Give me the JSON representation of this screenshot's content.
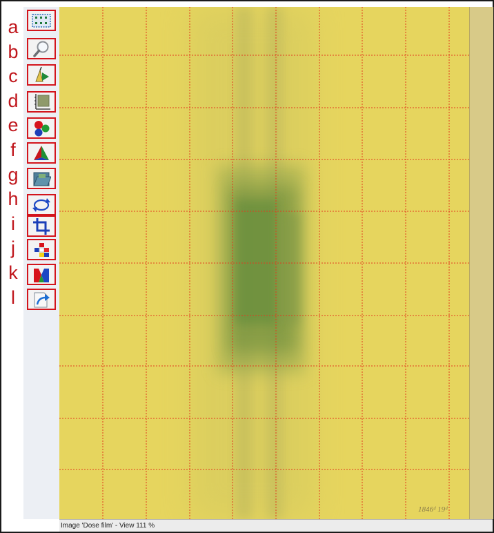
{
  "labels": [
    "a",
    "b",
    "c",
    "d",
    "e",
    "f",
    "g",
    "h",
    "i",
    "j",
    "k",
    "l"
  ],
  "toolbar": {
    "buttons": [
      {
        "icon": "selection-grid-icon"
      },
      {
        "icon": "magnifier-icon"
      },
      {
        "icon": "pen-arrow-icon"
      },
      {
        "icon": "histogram-axis-icon"
      },
      {
        "icon": "rgb-spheres-icon"
      },
      {
        "icon": "color-pyramid-icon"
      },
      {
        "icon": "image-folder-icon"
      },
      {
        "icon": "rotate-icon"
      },
      {
        "icon": "crop-icon"
      },
      {
        "icon": "color-blocks-icon"
      },
      {
        "icon": "color-channels-icon"
      },
      {
        "icon": "export-arrow-icon"
      }
    ]
  },
  "film": {
    "handwriting": "1846ᵈ 19ᵈ",
    "background_color": "#e6d55e",
    "grid_color": "#e23a1e",
    "dose_color": "#5f8a3a"
  },
  "status": {
    "text": "Image 'Dose film' - View  111 %"
  }
}
